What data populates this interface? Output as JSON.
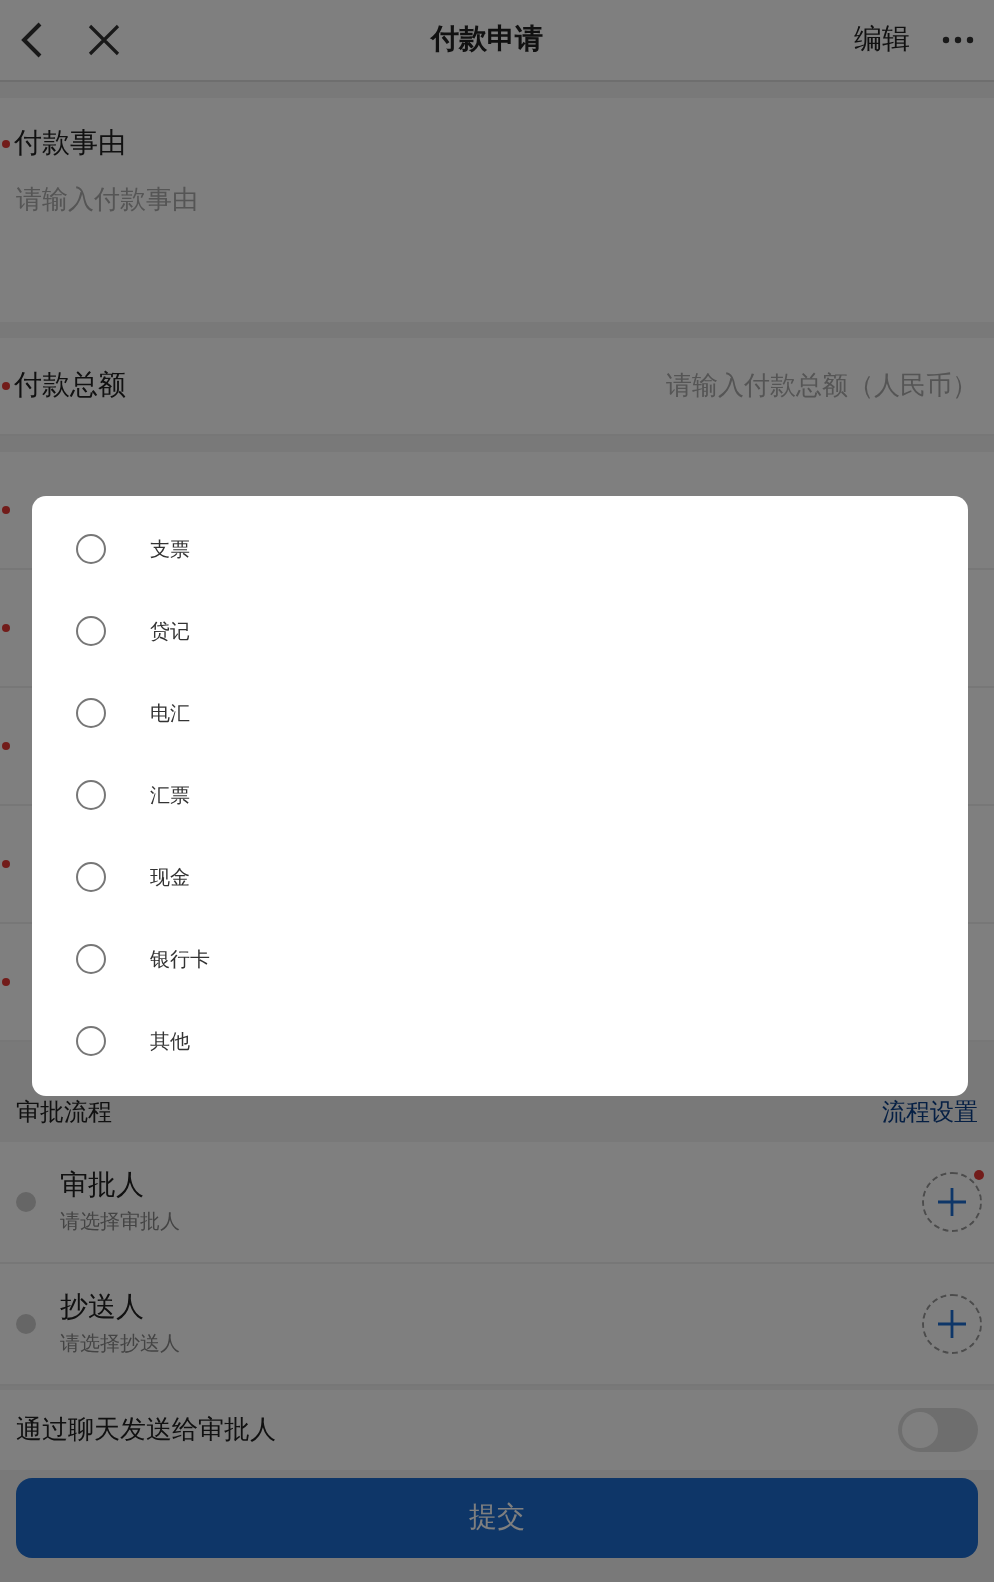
{
  "header": {
    "title": "付款申请",
    "action": "编辑"
  },
  "reason": {
    "label": "付款事由",
    "required": true,
    "placeholder": "请输入付款事由"
  },
  "amount": {
    "label": "付款总额",
    "required": true,
    "placeholder": "请输入付款总额（人民币）"
  },
  "hidden_rows": [
    {
      "required": true
    },
    {
      "required": true
    },
    {
      "required": true
    },
    {
      "required": true
    },
    {
      "required": true
    }
  ],
  "approval": {
    "title": "审批流程",
    "settings": "流程设置"
  },
  "people": [
    {
      "title": "审批人",
      "hint": "请选择审批人",
      "required": true
    },
    {
      "title": "抄送人",
      "hint": "请选择抄送人",
      "required": false
    }
  ],
  "notify": {
    "label": "通过聊天发送给审批人",
    "on": false
  },
  "submit": "提交",
  "dialog": {
    "options": [
      {
        "label": "支票",
        "selected": false
      },
      {
        "label": "贷记",
        "selected": false
      },
      {
        "label": "电汇",
        "selected": false
      },
      {
        "label": "汇票",
        "selected": false
      },
      {
        "label": "现金",
        "selected": false
      },
      {
        "label": "银行卡",
        "selected": false
      },
      {
        "label": "其他",
        "selected": false
      }
    ]
  }
}
